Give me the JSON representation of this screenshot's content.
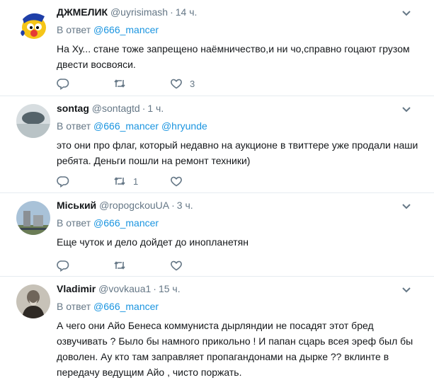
{
  "reply_prefix": "В ответ",
  "tweets": [
    {
      "name": "ДЖМЕЛИК",
      "handle": "@uyrisimash",
      "time": "14 ч.",
      "reply_to": [
        "@666_mancer"
      ],
      "text": "На Ху... стане тоже запрещено наёмничество,и ни чо,справно гоцают грузом двести восвояси.",
      "replies": "",
      "retweets": "",
      "likes": "3"
    },
    {
      "name": "sontag",
      "handle": "@sontagtd",
      "time": "1 ч.",
      "reply_to": [
        "@666_mancer",
        "@hryunde"
      ],
      "text": "это они про флаг, который недавно на аукционе в твиттере уже продали наши ребята. Деньги пошли на ремонт техники)",
      "replies": "",
      "retweets": "1",
      "likes": ""
    },
    {
      "name": "Міський",
      "handle": "@ropogckouUA",
      "time": "3 ч.",
      "reply_to": [
        "@666_mancer"
      ],
      "text": "Еще чуток и дело дойдет до инопланетян",
      "replies": "",
      "retweets": "",
      "likes": ""
    },
    {
      "name": "Vladimir",
      "handle": "@vovkaua1",
      "time": "15 ч.",
      "reply_to": [
        "@666_mancer"
      ],
      "text": "А чего они  Айо Бенеса коммуниста дырляндии  не посадят этот бред озвучивать ? Было бы намного прикольно ! И папан сцарь всея эреф был бы доволен. Ау кто там заправляет пропагандонами на дырке ?? вклинте в передачу ведущим Айо , чисто поржать.",
      "replies": "",
      "retweets": "",
      "likes": ""
    }
  ]
}
